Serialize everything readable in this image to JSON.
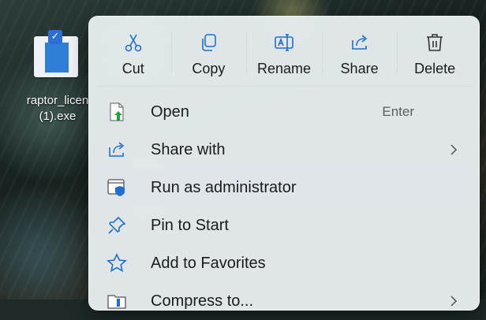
{
  "desktop": {
    "icon_label": "raptor_licen\n(1).exe",
    "icon_name": "exe-file-icon"
  },
  "menu": {
    "toolbar": [
      {
        "label": "Cut",
        "icon": "scissors-icon"
      },
      {
        "label": "Copy",
        "icon": "copy-icon"
      },
      {
        "label": "Rename",
        "icon": "rename-icon"
      },
      {
        "label": "Share",
        "icon": "share-icon"
      },
      {
        "label": "Delete",
        "icon": "trash-icon"
      }
    ],
    "items": [
      {
        "label": "Open",
        "shortcut": "Enter",
        "icon": "open-file-icon"
      },
      {
        "label": "Share with",
        "icon": "share-with-icon",
        "has_submenu": true
      },
      {
        "label": "Run as administrator",
        "icon": "shield-icon",
        "highlighted": true
      },
      {
        "label": "Pin to Start",
        "icon": "pin-icon"
      },
      {
        "label": "Add to Favorites",
        "icon": "star-icon"
      },
      {
        "label": "Compress to...",
        "icon": "zip-folder-icon",
        "has_submenu": true
      }
    ]
  },
  "colors": {
    "accent": "#2b6fd6",
    "icon_blue": "#1f6fd1",
    "menu_bg": "#e8eef0",
    "hover_bg": "#dfe5e8"
  }
}
